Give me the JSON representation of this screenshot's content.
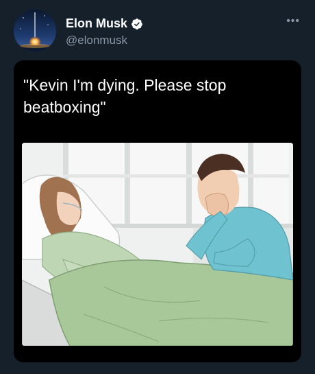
{
  "tweet": {
    "display_name": "Elon Musk",
    "handle": "@elonmusk",
    "verified_icon": "verified-badge-icon",
    "more_icon": "more-options-icon",
    "more_label": "•••",
    "quote_text": "\"Kevin I'm dying. Please stop beatboxing\""
  },
  "image": {
    "description_icon": "hospital-bed-illustration"
  },
  "colors": {
    "background": "#15202b",
    "card": "#000000",
    "text_primary": "#ffffff",
    "text_secondary": "#8b98a5",
    "verified": "#ffffff"
  }
}
